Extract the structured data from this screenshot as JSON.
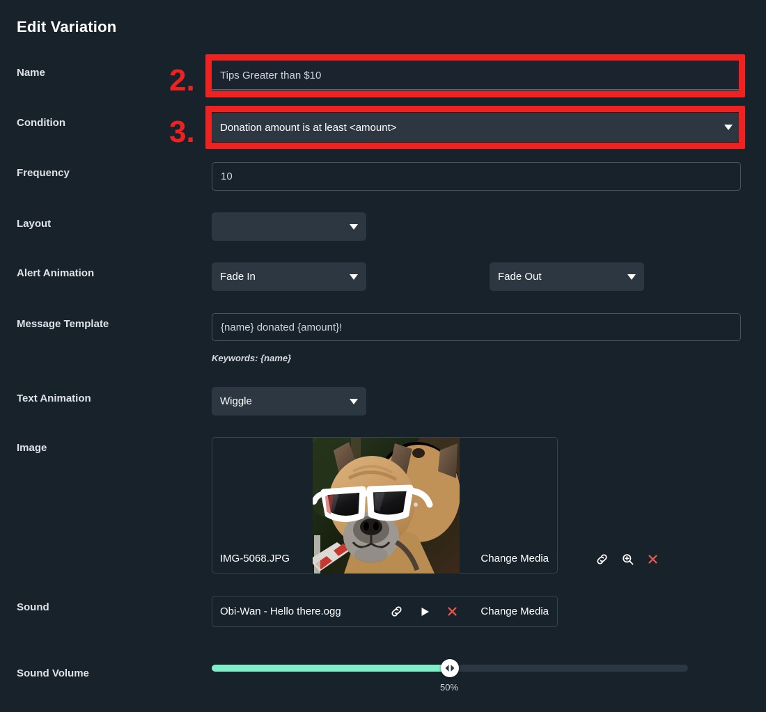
{
  "header": {
    "title": "Edit Variation"
  },
  "fields": {
    "name": {
      "label": "Name",
      "value": "Tips Greater than $10",
      "placeholder": "Name"
    },
    "condition": {
      "label": "Condition",
      "value": "Donation amount is at least <amount>"
    },
    "frequency": {
      "label": "Frequency",
      "value": "10",
      "placeholder": "Frequency"
    },
    "layout": {
      "label": "Layout",
      "value": ""
    },
    "alert_animation": {
      "label": "Alert Animation",
      "in_value": "Fade In",
      "out_value": "Fade Out"
    },
    "message_template": {
      "label": "Message Template",
      "value": "{name} donated {amount}!",
      "placeholder": "Message Template",
      "hint": "Keywords: {name}"
    },
    "text_animation": {
      "label": "Text Animation",
      "value": "Wiggle"
    },
    "image": {
      "label": "Image",
      "file_name": "IMG-5068.JPG",
      "change_label": "Change Media",
      "icons": [
        "link-icon",
        "zoom-in-icon",
        "remove-icon"
      ]
    },
    "sound": {
      "label": "Sound",
      "file_name": "Obi-Wan - Hello there.ogg",
      "change_label": "Change Media",
      "icons": [
        "link-icon",
        "play-icon",
        "remove-icon"
      ]
    },
    "sound_volume": {
      "label": "Sound Volume",
      "value_label": "50%",
      "percent": 50
    }
  },
  "annotations": [
    {
      "number": "2.",
      "target": "name-input"
    },
    {
      "number": "3.",
      "target": "condition-select"
    }
  ],
  "colors": {
    "page_background": "#18222b",
    "select_background": "#2c3742",
    "annotation_red": "#ef2222",
    "slider_fill": "#80efc8",
    "remove_icon_red": "#e8574a",
    "text_primary": "#ffffff"
  }
}
